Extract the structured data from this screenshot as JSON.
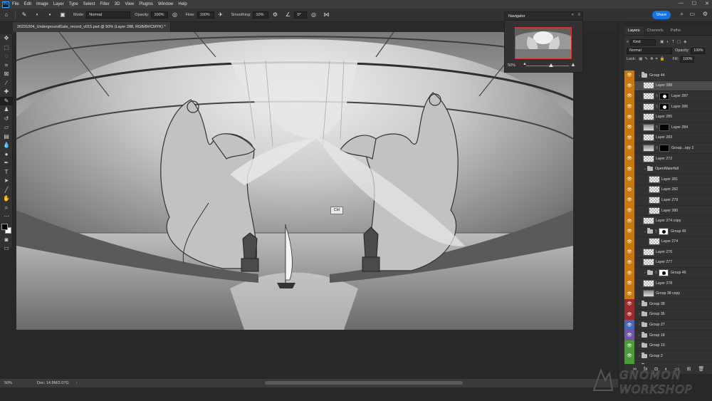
{
  "app": {
    "logo": "Ps"
  },
  "menu": [
    "File",
    "Edit",
    "Image",
    "Layer",
    "Type",
    "Select",
    "Filter",
    "3D",
    "View",
    "Plugins",
    "Window",
    "Help"
  ],
  "options": {
    "mode_label": "Mode:",
    "mode_value": "Normal",
    "opacity_label": "Opacity:",
    "opacity_value": "100%",
    "flow_label": "Flow:",
    "flow_value": "100%",
    "smoothing_label": "Smoothing:",
    "smoothing_value": "10%",
    "angle_value": "0°",
    "share_label": "Share"
  },
  "document": {
    "tab_title": "20231004_UndergroundGate_record_v015.psd @ 50% (Layer 288, RGB/8#/CMYK) *"
  },
  "canvas": {
    "tooltip": "Ctrl"
  },
  "navigator": {
    "title": "Navigator",
    "zoom": "50%"
  },
  "layers_panel": {
    "tabs": [
      "Layers",
      "Channels",
      "Paths"
    ],
    "filter_kind": "Kind",
    "blend_mode": "Normal",
    "opacity_label": "Opacity:",
    "opacity_value": "100%",
    "lock_label": "Lock:",
    "fill_label": "Fill:",
    "fill_value": "100%",
    "layers": [
      {
        "name": "Group 44",
        "kind": "group",
        "indent": 0,
        "expanded": true,
        "eye": "#c7790d"
      },
      {
        "name": "Layer 288",
        "kind": "layer",
        "indent": 1,
        "eye": "#c7790d",
        "selected": true
      },
      {
        "name": "Layer 287",
        "kind": "masked",
        "indent": 1,
        "eye": "#c7790d",
        "mask": "dot"
      },
      {
        "name": "Layer 286",
        "kind": "masked",
        "indent": 1,
        "eye": "#c7790d",
        "mask": "dot"
      },
      {
        "name": "Layer 285",
        "kind": "layer",
        "indent": 1,
        "eye": "#c7790d"
      },
      {
        "name": "Layer 284",
        "kind": "masked",
        "indent": 1,
        "eye": "#c7790d",
        "mask": "black",
        "thumb": "img"
      },
      {
        "name": "Layer 283",
        "kind": "layer",
        "indent": 1,
        "eye": "#c7790d"
      },
      {
        "name": "Group...opy 2",
        "kind": "masked",
        "indent": 1,
        "eye": "#c7790d",
        "mask": "black",
        "thumb": "img"
      },
      {
        "name": "Layer 272",
        "kind": "layer",
        "indent": 1,
        "eye": "#c7790d"
      },
      {
        "name": "OpenWaterfall",
        "kind": "group",
        "indent": 1,
        "expanded": true,
        "eye": "#c7790d"
      },
      {
        "name": "Layer 281",
        "kind": "layer",
        "indent": 2,
        "eye": "#c7790d"
      },
      {
        "name": "Layer 282",
        "kind": "layer",
        "indent": 2,
        "eye": "#c7790d"
      },
      {
        "name": "Layer 279",
        "kind": "layer",
        "indent": 2,
        "eye": "#c7790d"
      },
      {
        "name": "Layer 280",
        "kind": "layer",
        "indent": 2,
        "eye": "#c7790d"
      },
      {
        "name": "Layer 274 copy",
        "kind": "layer",
        "indent": 1,
        "eye": "#c7790d"
      },
      {
        "name": "Group 45",
        "kind": "groupmask",
        "indent": 1,
        "expanded": true,
        "eye": "#c7790d"
      },
      {
        "name": "Layer 274",
        "kind": "layer",
        "indent": 2,
        "eye": "#c7790d"
      },
      {
        "name": "Layer 276",
        "kind": "layer",
        "indent": 1,
        "eye": "#c7790d"
      },
      {
        "name": "Layer 277",
        "kind": "layer",
        "indent": 1,
        "eye": "#c7790d"
      },
      {
        "name": "Group 46",
        "kind": "groupmask",
        "indent": 1,
        "expanded": false,
        "eye": "#c7790d"
      },
      {
        "name": "Layer 278",
        "kind": "layer",
        "indent": 1,
        "eye": "#c7790d"
      },
      {
        "name": "Group 38 copy",
        "kind": "layer",
        "indent": 1,
        "eye": "#c7790d",
        "thumb": "img"
      },
      {
        "name": "Group 38",
        "kind": "group",
        "indent": 0,
        "expanded": false,
        "eye": "#9c2a2a"
      },
      {
        "name": "Group 36",
        "kind": "group",
        "indent": 0,
        "expanded": false,
        "eye": "#9c2a2a"
      },
      {
        "name": "Group 27",
        "kind": "group",
        "indent": 0,
        "expanded": false,
        "eye": "#4b66b5"
      },
      {
        "name": "Group 18",
        "kind": "group",
        "indent": 0,
        "expanded": false,
        "eye": "#7355a8"
      },
      {
        "name": "Group 10",
        "kind": "group",
        "indent": 0,
        "expanded": false,
        "eye": "#4c9a3a"
      },
      {
        "name": "Group 2",
        "kind": "group",
        "indent": 0,
        "expanded": false,
        "eye": "#4c9a3a"
      },
      {
        "name": "Group 1",
        "kind": "group",
        "indent": 0,
        "expanded": false,
        "eye": "#4c9a3a"
      }
    ]
  },
  "status": {
    "zoom": "50%",
    "doc": "Doc: 14.9M/2.07G"
  },
  "watermark": {
    "line1": "GNOMON",
    "line2": "WORKSHOP"
  }
}
